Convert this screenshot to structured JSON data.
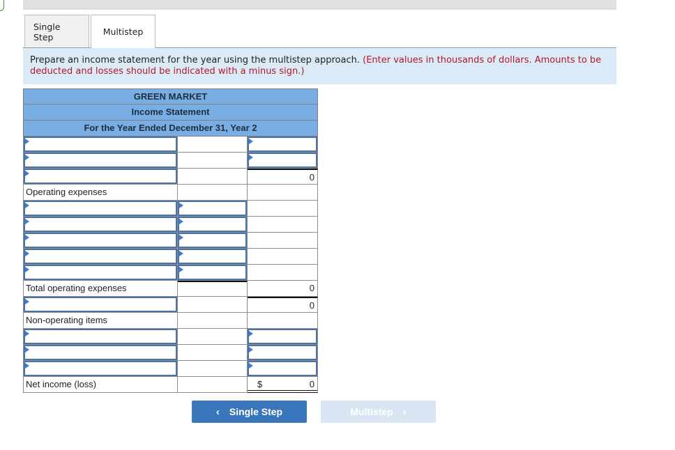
{
  "tabs": [
    {
      "label": "Single Step",
      "active": false
    },
    {
      "label": "Multistep",
      "active": true
    }
  ],
  "instructions": {
    "main": "Prepare an income statement for the year using the multistep approach.",
    "note": "(Enter values in thousands of dollars. Amounts to be deducted and losses should be indicated with a minus sign.)"
  },
  "statement": {
    "company": "GREEN MARKET",
    "title": "Income Statement",
    "period": "For the Year Ended December 31, Year 2",
    "rows": [
      {
        "label": "",
        "col2": "",
        "col3": ""
      },
      {
        "label": "",
        "col2": "",
        "col3": ""
      },
      {
        "label": "",
        "col2": "",
        "col3": "0"
      },
      {
        "label": "Operating expenses",
        "col2": "",
        "col3": ""
      },
      {
        "label": "",
        "col2": "",
        "col3": ""
      },
      {
        "label": "",
        "col2": "",
        "col3": ""
      },
      {
        "label": "",
        "col2": "",
        "col3": ""
      },
      {
        "label": "",
        "col2": "",
        "col3": ""
      },
      {
        "label": "",
        "col2": "",
        "col3": ""
      },
      {
        "label": "Total operating expenses",
        "col2": "",
        "col3": "0"
      },
      {
        "label": "",
        "col2": "",
        "col3": "0"
      },
      {
        "label": "Non-operating items",
        "col2": "",
        "col3": ""
      },
      {
        "label": "",
        "col2": "",
        "col3": ""
      },
      {
        "label": "",
        "col2": "",
        "col3": ""
      },
      {
        "label": "",
        "col2": "",
        "col3": ""
      },
      {
        "label": "Net income (loss)",
        "col2": "",
        "currency": "$",
        "col3": "0"
      }
    ]
  },
  "nav": {
    "prev_label": "Single Step",
    "prev_icon": "‹",
    "next_label": "Multistep",
    "next_icon": "›"
  },
  "colors": {
    "header_blue": "#78aee4",
    "instruction_bg": "#dbeaf7",
    "note_red": "#b0192b",
    "button_blue": "#3a76bb",
    "button_disabled": "#d9e5f3"
  }
}
